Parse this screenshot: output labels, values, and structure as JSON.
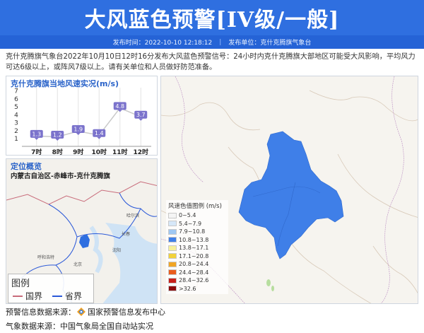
{
  "header": {
    "title": "大风蓝色预警[IV级/一般]",
    "publish_time": "发布时间：2022-10-10 12:18:12",
    "publisher": "发布单位：克什克腾旗气象台"
  },
  "description": "克什克腾旗气象台2022年10月10日12时16分发布大风蓝色预警信号：24小时内克什克腾旗大部地区可能受大风影响，平均风力可达6级以上，或阵风7级以上。请有关单位和人员做好防范准备。",
  "wind_chart": {
    "title": "克什克腾旗当地风速实况(m/s)",
    "y_ticks": [
      "1",
      "2",
      "3",
      "4",
      "5",
      "6",
      "7"
    ],
    "chart_data": {
      "type": "line",
      "title": "克什克腾旗当地风速实况(m/s)",
      "categories": [
        "7时",
        "8时",
        "9时",
        "10时",
        "11时",
        "12时"
      ],
      "values": [
        1.3,
        1.2,
        1.9,
        1.4,
        4.8,
        3.7
      ],
      "value_labels": [
        "1.3",
        "1.2",
        "1.9",
        "1.4",
        "4.8",
        "3.7"
      ],
      "ylim": [
        0,
        7
      ],
      "ylabel": "",
      "xlabel": "",
      "colors": {
        "line": "#c9c9c9",
        "label_bg": "#7b73cc",
        "label_text": "#ffffff"
      }
    }
  },
  "location": {
    "title": "定位概览",
    "path": "内蒙古自治区-赤峰市-克什克腾旗",
    "cities": [
      "哈尔滨",
      "长春",
      "沈阳",
      "呼和浩特",
      "北京"
    ],
    "legend": {
      "title": "图例",
      "items": [
        {
          "label": "国界",
          "color": "#c86b7a"
        },
        {
          "label": "省界",
          "color": "#2b59d8"
        }
      ]
    }
  },
  "map": {
    "region_color": "#3f7fe8",
    "legend": {
      "title": "风速色值图例 (m/s)",
      "items": [
        {
          "label": "0~5.4",
          "color": "#f5f5f5"
        },
        {
          "label": "5.4~7.9",
          "color": "#d6e7f8"
        },
        {
          "label": "7.9~10.8",
          "color": "#9fc8f3"
        },
        {
          "label": "10.8~13.8",
          "color": "#3f7fe8"
        },
        {
          "label": "13.8~17.1",
          "color": "#f7f09a"
        },
        {
          "label": "17.1~20.8",
          "color": "#f2d23a"
        },
        {
          "label": "20.8~24.4",
          "color": "#f1a524"
        },
        {
          "label": "24.4~28.4",
          "color": "#ea5c1c"
        },
        {
          "label": "28.4~32.6",
          "color": "#c8201a"
        },
        {
          "label": ">32.6",
          "color": "#8e0c0c"
        }
      ]
    }
  },
  "footer": {
    "source1": "预警信息数据来源：",
    "source1_name": "国家预警信息发布中心",
    "source2": "气象数据来源：中国气象局全国自动站实况"
  }
}
